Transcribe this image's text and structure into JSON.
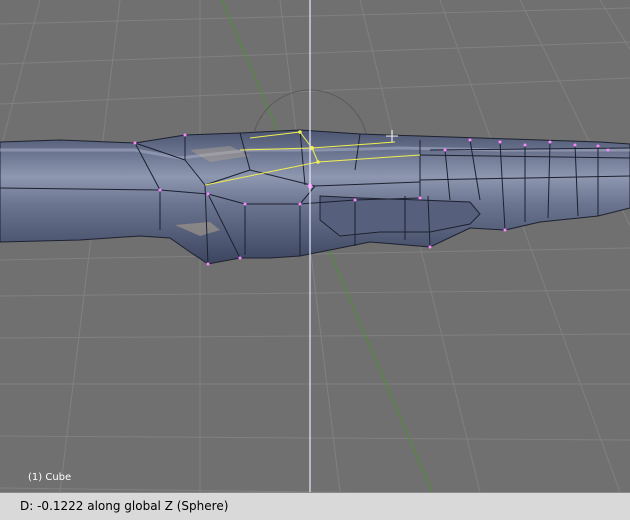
{
  "viewport": {
    "object_label": "(1) Cube",
    "background_color": "#707070",
    "grid_color": "#7f7f7f",
    "mesh_color": "#5f6a86",
    "selection_color": "#f0f050",
    "vertex_color": "#ff88ff",
    "z_axis_color": "#4f8f3a",
    "cursor_line_color": "#e8e8ff"
  },
  "status_bar": {
    "text": "D: -0.1222 along global Z (Sphere)"
  },
  "icons": [
    "3d-cursor-icon",
    "proportional-edit-circle-icon"
  ]
}
